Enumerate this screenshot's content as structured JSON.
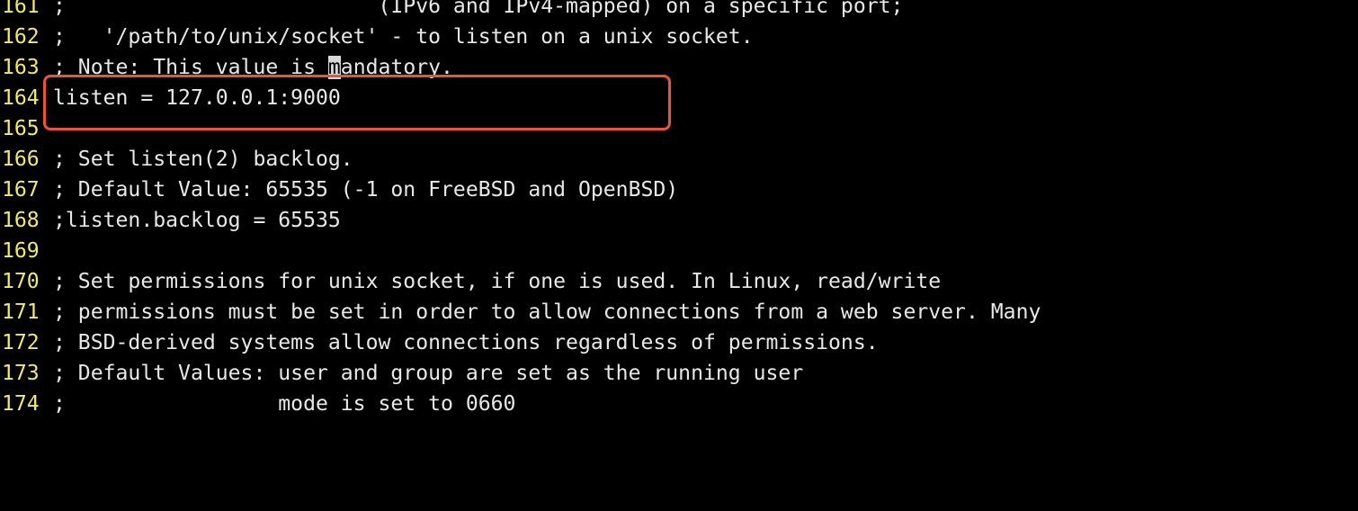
{
  "lines": [
    {
      "num": "161",
      "text": ";                         (IPv6 and IPv4-mapped) on a specific port;"
    },
    {
      "num": "162",
      "text": ";   '/path/to/unix/socket' - to listen on a unix socket."
    },
    {
      "num": "163",
      "pre": "; Note: This value is ",
      "cursor": "m",
      "post": "andatory."
    },
    {
      "num": "164",
      "text": "listen = 127.0.0.1:9000"
    },
    {
      "num": "165",
      "text": ""
    },
    {
      "num": "166",
      "text": "; Set listen(2) backlog."
    },
    {
      "num": "167",
      "text": "; Default Value: 65535 (-1 on FreeBSD and OpenBSD)"
    },
    {
      "num": "168",
      "text": ";listen.backlog = 65535"
    },
    {
      "num": "169",
      "text": ""
    },
    {
      "num": "170",
      "text": "; Set permissions for unix socket, if one is used. In Linux, read/write"
    },
    {
      "num": "171",
      "text": "; permissions must be set in order to allow connections from a web server. Many"
    },
    {
      "num": "172",
      "text": "; BSD-derived systems allow connections regardless of permissions."
    },
    {
      "num": "173",
      "text": "; Default Values: user and group are set as the running user"
    },
    {
      "num": "174",
      "text": ";                 mode is set to 0660"
    }
  ],
  "colors": {
    "background": "#000000",
    "line_number": "#f0e96a",
    "text": "#e8e8e8",
    "annotation_box": "#e8533a",
    "cursor": "#d8d8d8"
  }
}
